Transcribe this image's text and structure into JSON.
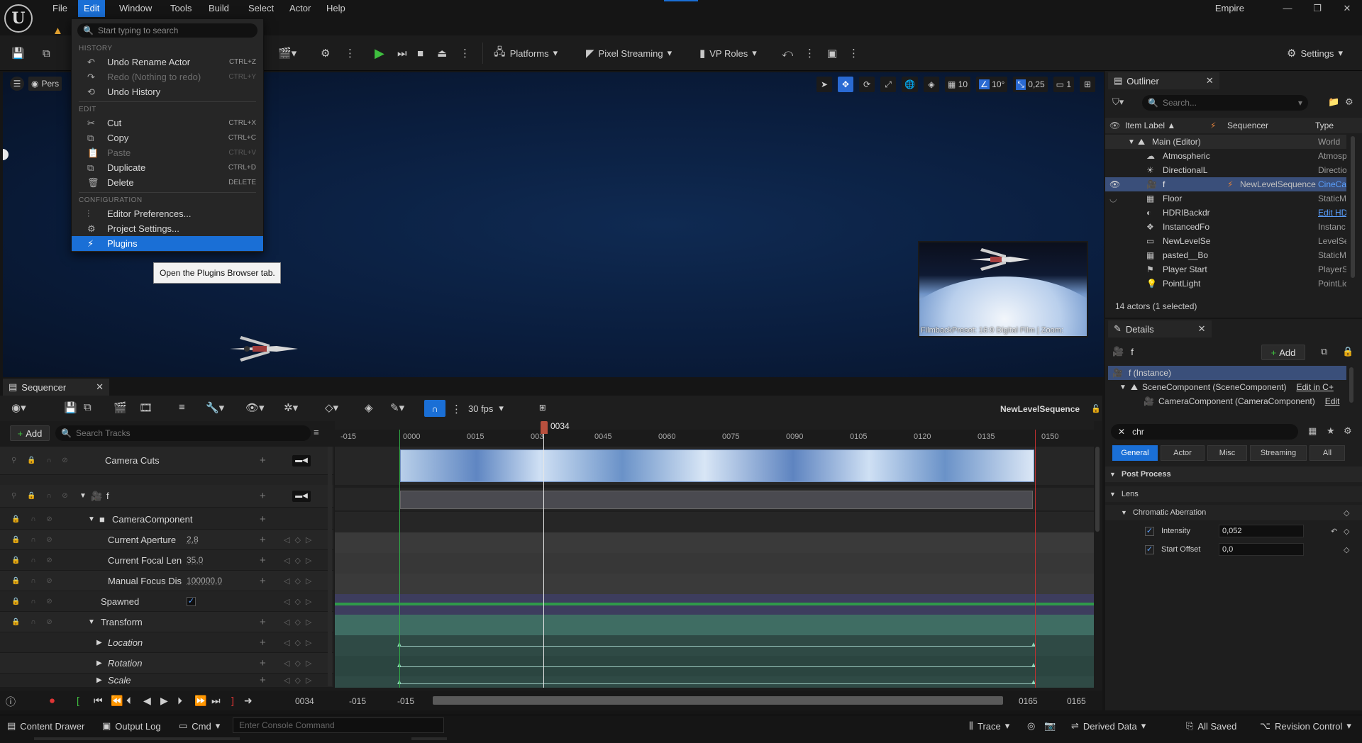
{
  "menubar": {
    "items": [
      "File",
      "Edit",
      "Window",
      "Tools",
      "Build",
      "Select",
      "Actor",
      "Help"
    ],
    "active": "Edit",
    "project": "Empire"
  },
  "toolbar": {
    "platforms": "Platforms",
    "pixel_streaming": "Pixel Streaming",
    "vp_roles": "VP Roles",
    "settings": "Settings"
  },
  "viewport": {
    "view_label": "Pers",
    "grid": "10",
    "angle": "10°",
    "scale": "0,25",
    "cam_speed": "1",
    "preview_caption": "FilmbackPreset: 16:9 Digital Film | Zoom:"
  },
  "edit_menu": {
    "search_placeholder": "Start typing to search",
    "sections": {
      "history": "HISTORY",
      "edit": "EDIT",
      "configuration": "CONFIGURATION"
    },
    "history": [
      {
        "label": "Undo Rename Actor",
        "shortcut": "CTRL+Z",
        "disabled": false
      },
      {
        "label": "Redo (Nothing to redo)",
        "shortcut": "CTRL+Y",
        "disabled": true
      },
      {
        "label": "Undo History",
        "shortcut": "",
        "disabled": false
      }
    ],
    "edit": [
      {
        "label": "Cut",
        "shortcut": "CTRL+X",
        "disabled": false
      },
      {
        "label": "Copy",
        "shortcut": "CTRL+C",
        "disabled": false
      },
      {
        "label": "Paste",
        "shortcut": "CTRL+V",
        "disabled": true
      },
      {
        "label": "Duplicate",
        "shortcut": "CTRL+D",
        "disabled": false
      },
      {
        "label": "Delete",
        "shortcut": "DELETE",
        "disabled": false
      }
    ],
    "configuration": [
      {
        "label": "Editor Preferences...",
        "shortcut": ""
      },
      {
        "label": "Project Settings...",
        "shortcut": ""
      },
      {
        "label": "Plugins",
        "shortcut": ""
      }
    ],
    "tooltip": "Open the Plugins Browser tab."
  },
  "outliner": {
    "title": "Outliner",
    "search_placeholder": "Search...",
    "columns": {
      "label": "Item Label ▲",
      "sequencer": "Sequencer",
      "type": "Type"
    },
    "root": {
      "name": "Main (Editor)",
      "type": "World"
    },
    "rows": [
      {
        "name": "Atmospheric",
        "seq": "",
        "type": "Atmosp",
        "selected": false
      },
      {
        "name": "DirectionalL",
        "seq": "",
        "type": "Directio",
        "selected": false
      },
      {
        "name": "f",
        "seq": "NewLevelSequence",
        "type": "CineCam",
        "selected": true
      },
      {
        "name": "Floor",
        "seq": "",
        "type": "StaticM",
        "selected": false
      },
      {
        "name": "HDRIBackdr",
        "seq": "",
        "type": "Edit HD",
        "selected": false
      },
      {
        "name": "InstancedFo",
        "seq": "",
        "type": "Instanc",
        "selected": false
      },
      {
        "name": "NewLevelSe",
        "seq": "",
        "type": "LevelSe",
        "selected": false
      },
      {
        "name": "pasted__Bo",
        "seq": "",
        "type": "StaticM",
        "selected": false
      },
      {
        "name": "Player Start",
        "seq": "",
        "type": "PlayerS",
        "selected": false
      },
      {
        "name": "PointLight",
        "seq": "",
        "type": "PointLic",
        "selected": false
      }
    ],
    "count": "14 actors (1 selected)"
  },
  "details": {
    "title": "Details",
    "actor": "f",
    "add_label": "Add",
    "instance": "f (Instance)",
    "scene_component": "SceneComponent (SceneComponent)",
    "scene_edit": "Edit in C+",
    "camera_component": "CameraComponent (CameraComponent)",
    "camera_edit": "Edit",
    "filter_value": "chr",
    "tabs": [
      "General",
      "Actor",
      "Misc",
      "Streaming",
      "All"
    ],
    "post_process": "Post Process",
    "lens": "Lens",
    "chromatic": "Chromatic Aberration",
    "intensity_label": "Intensity",
    "intensity_value": "0,052",
    "start_offset_label": "Start Offset",
    "start_offset_value": "0,0"
  },
  "sequencer": {
    "tab": "Sequencer",
    "fps": "30 fps",
    "sequence_name": "NewLevelSequence",
    "add_label": "Add",
    "search_placeholder": "Search Tracks",
    "playhead": "0034",
    "ruler": [
      "-015",
      "0000",
      "0015",
      "003",
      "0045",
      "0060",
      "0075",
      "0090",
      "0105",
      "0120",
      "0135",
      "0150"
    ],
    "tracks": {
      "camera_cuts": "Camera Cuts",
      "f": "f",
      "camera_component": "CameraComponent",
      "aperture": "Current Aperture",
      "aperture_val": "2,8",
      "focal": "Current Focal Len",
      "focal_val": "35,0",
      "focus": "Manual Focus Dis",
      "focus_val": "100000,0",
      "spawned": "Spawned",
      "transform": "Transform",
      "location": "Location",
      "rotation": "Rotation",
      "scale": "Scale"
    },
    "transport": {
      "current": "0034",
      "start_view": "-015",
      "start": "-015",
      "end": "0165",
      "end_view": "0165"
    }
  },
  "statusbar": {
    "content_drawer": "Content Drawer",
    "output_log": "Output Log",
    "cmd": "Cmd",
    "console_placeholder": "Enter Console Command",
    "trace": "Trace",
    "derived_data": "Derived Data",
    "all_saved": "All Saved",
    "revision_control": "Revision Control"
  }
}
